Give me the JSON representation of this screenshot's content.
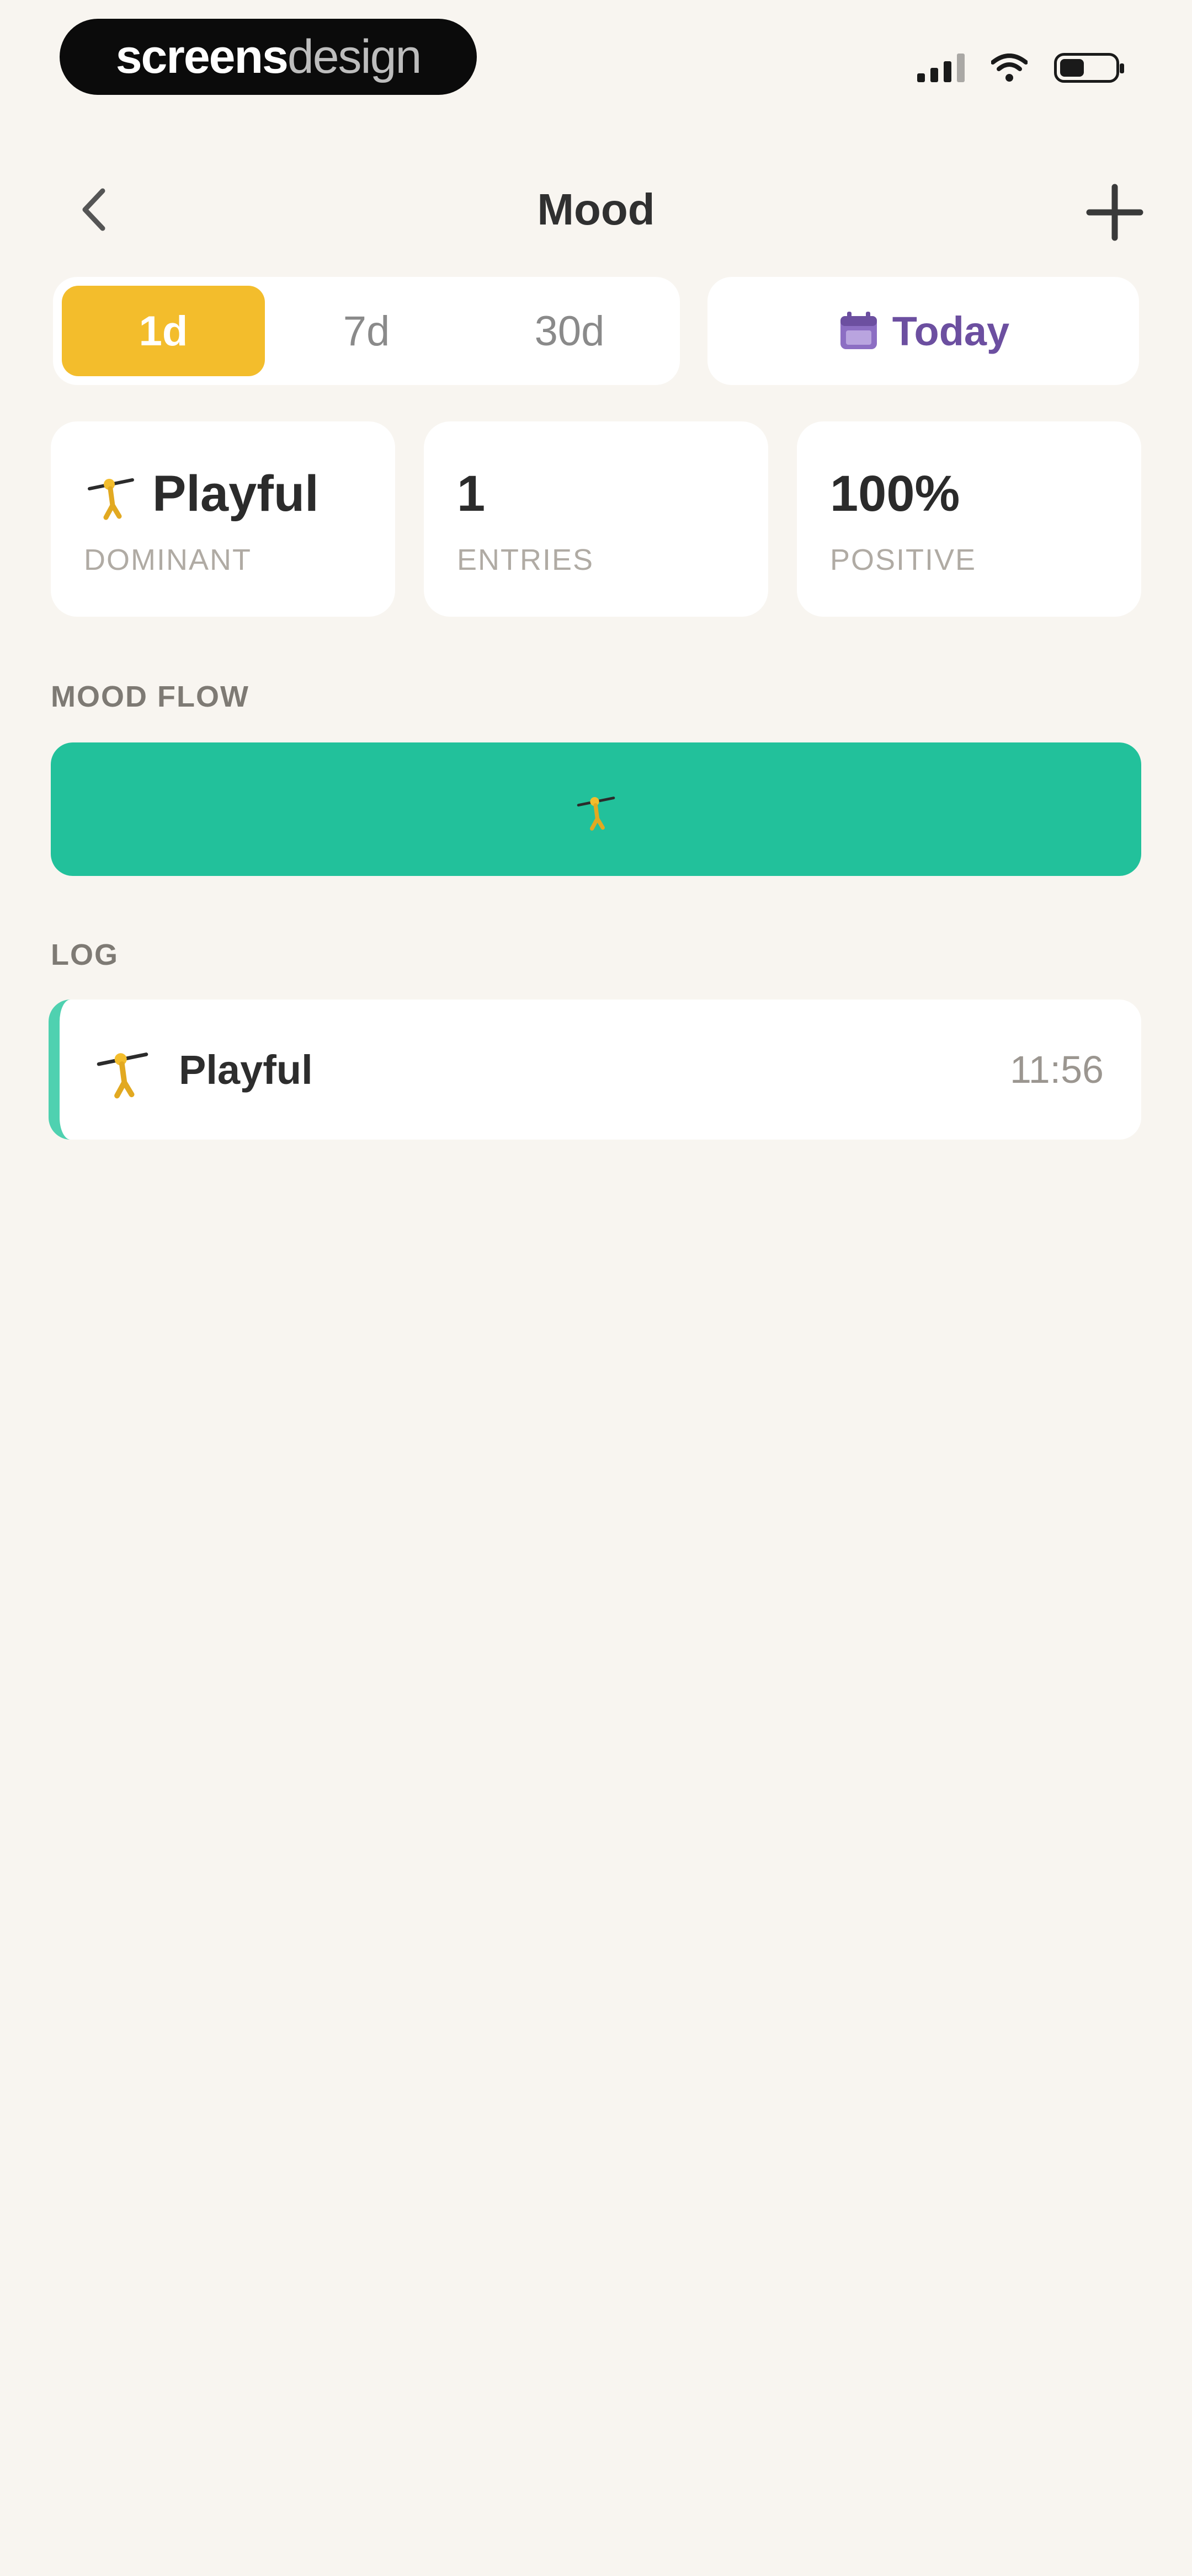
{
  "status_bar": {
    "brand_bold": "screens",
    "brand_light": "design",
    "battery_fraction": 0.45,
    "icons": [
      "signal-icon",
      "wifi-icon",
      "battery-icon"
    ]
  },
  "header": {
    "title": "Mood",
    "back_icon": "chevron-left-icon",
    "add_icon": "plus-icon"
  },
  "range_tabs": [
    {
      "label": "1d",
      "active": true
    },
    {
      "label": "7d",
      "active": false
    },
    {
      "label": "30d",
      "active": false
    }
  ],
  "date_button": {
    "label": "Today",
    "icon": "calendar-icon"
  },
  "stats": {
    "dominant": {
      "value": "Playful",
      "label": "DOMINANT",
      "icon": "playful-mood-icon"
    },
    "entries": {
      "value": "1",
      "label": "ENTRIES"
    },
    "positive": {
      "value": "100%",
      "label": "POSITIVE"
    }
  },
  "mood_flow": {
    "title": "MOOD FLOW",
    "color": "#22c19b",
    "icon": "playful-mood-icon"
  },
  "log": {
    "title": "LOG",
    "items": [
      {
        "mood": "Playful",
        "time": "11:56",
        "icon": "playful-mood-icon",
        "accent": "#4fd1b0"
      }
    ]
  },
  "colors": {
    "background": "#f8f5f0",
    "accent_yellow": "#f3bd2c",
    "accent_purple": "#6c4fa0",
    "accent_green": "#22c19b"
  }
}
